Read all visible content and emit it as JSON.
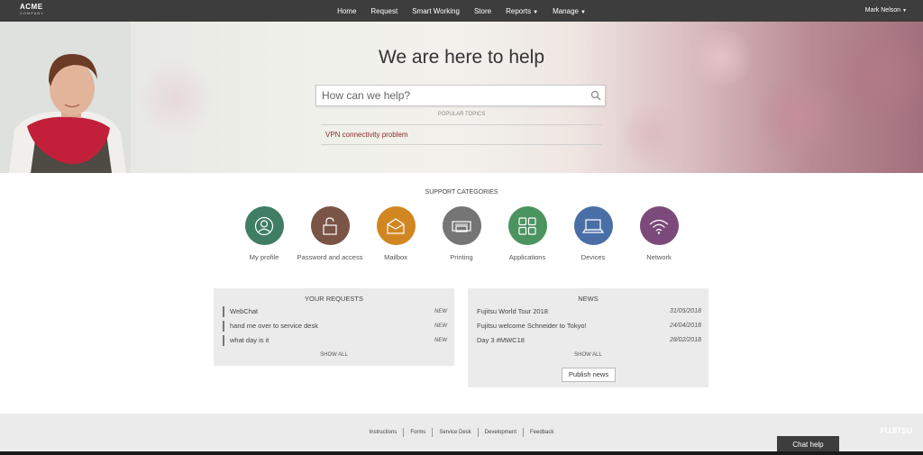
{
  "header": {
    "logo_line1": "ACME",
    "logo_line2": "COMPANY",
    "nav": [
      {
        "label": "Home",
        "dropdown": false
      },
      {
        "label": "Request",
        "dropdown": false
      },
      {
        "label": "Smart Working",
        "dropdown": false
      },
      {
        "label": "Store",
        "dropdown": false
      },
      {
        "label": "Reports",
        "dropdown": true
      },
      {
        "label": "Manage",
        "dropdown": true
      }
    ],
    "user_name": "Mark Nelson"
  },
  "hero": {
    "title": "We are here to help",
    "search_placeholder": "How can we help?",
    "popular_title": "POPULAR TOPICS",
    "popular_topics": [
      "VPN connectivity problem"
    ]
  },
  "categories": {
    "title": "SUPPORT CATEGORIES",
    "items": [
      {
        "label": "My profile",
        "color": "#3f7d64",
        "icon": "user-icon"
      },
      {
        "label": "Password and access",
        "color": "#7a5446",
        "icon": "lock-icon"
      },
      {
        "label": "Mailbox",
        "color": "#d18622",
        "icon": "envelope-icon"
      },
      {
        "label": "Printing",
        "color": "#757575",
        "icon": "printer-icon"
      },
      {
        "label": "Applications",
        "color": "#4b9460",
        "icon": "grid-icon"
      },
      {
        "label": "Devices",
        "color": "#4a6ea6",
        "icon": "laptop-icon"
      },
      {
        "label": "Network",
        "color": "#7c4a7a",
        "icon": "wifi-icon"
      }
    ]
  },
  "requests": {
    "title": "YOUR REQUESTS",
    "items": [
      {
        "text": "WebChat",
        "badge": "NEW"
      },
      {
        "text": "hand me over to service desk",
        "badge": "NEW"
      },
      {
        "text": "what day is it",
        "badge": "NEW"
      }
    ],
    "show_all": "SHOW ALL"
  },
  "news": {
    "title": "NEWS",
    "items": [
      {
        "text": "Fujitsu World Tour 2018",
        "date": "31/05/2018"
      },
      {
        "text": "Fujitsu welcome Schneider to Tokyo!",
        "date": "24/04/2018"
      },
      {
        "text": "Day 3 #MWC18",
        "date": "28/02/2018"
      }
    ],
    "show_all": "SHOW ALL",
    "publish_label": "Publish news"
  },
  "footer": {
    "links": [
      "Instructions",
      "Forms",
      "Service Desk",
      "Development",
      "Feedback"
    ],
    "brand": "FUJITSU"
  },
  "chat": {
    "label": "Chat help"
  },
  "colors": {
    "topbar": "#3d3d3d",
    "popular_link": "#8a2a2a"
  }
}
